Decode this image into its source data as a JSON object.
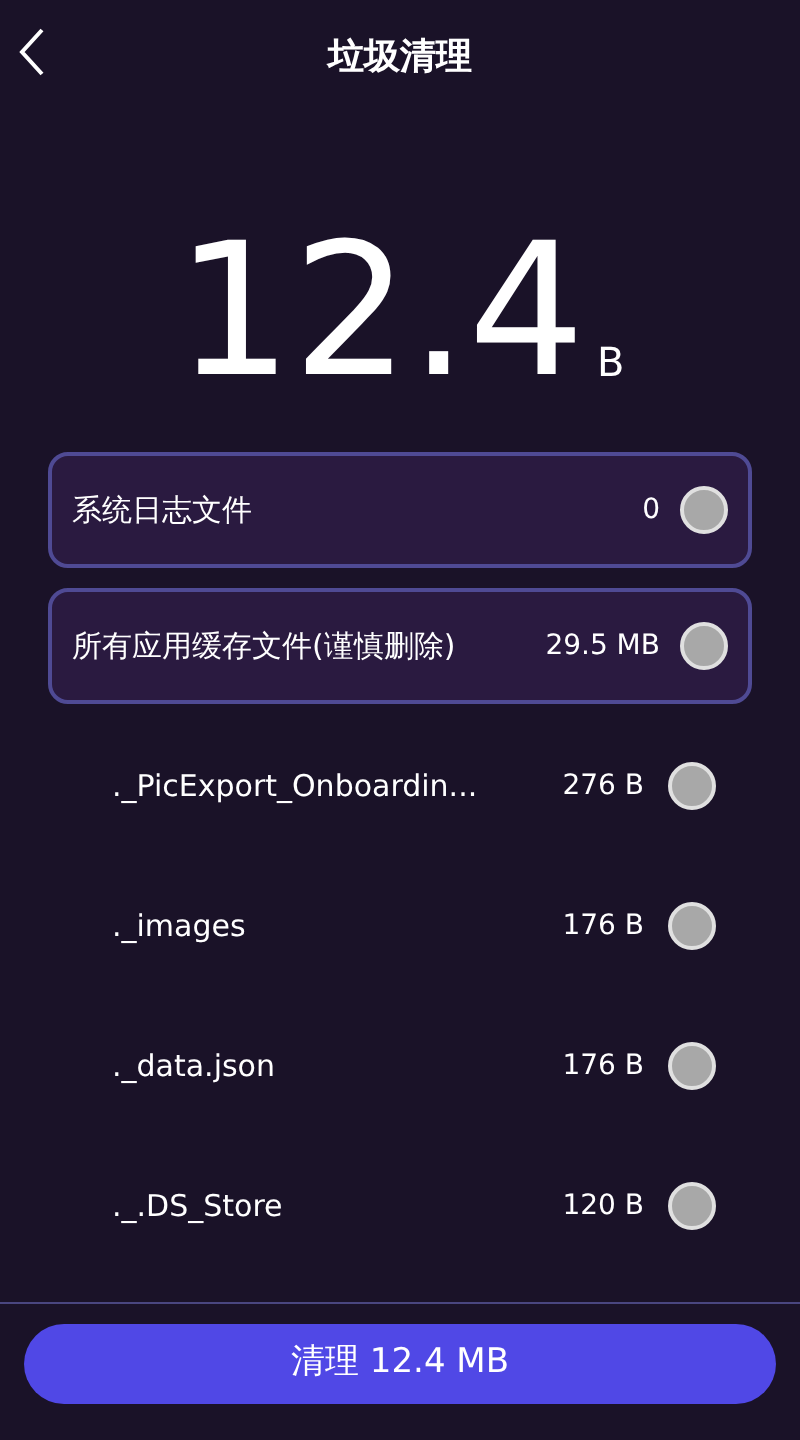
{
  "header": {
    "title": "垃圾清理"
  },
  "total": {
    "value": "12.4",
    "unit": "B"
  },
  "categories": [
    {
      "label": "系统日志文件",
      "size": "0",
      "checked": false
    },
    {
      "label": "所有应用缓存文件(谨慎删除)",
      "size": "29.5 MB",
      "checked": false
    }
  ],
  "files": [
    {
      "name": "._PicExport_Onboardin...",
      "size": "276 B",
      "checked": false
    },
    {
      "name": "._images",
      "size": "176 B",
      "checked": false
    },
    {
      "name": "._data.json",
      "size": "176 B",
      "checked": false
    },
    {
      "name": "._.DS_Store",
      "size": "120 B",
      "checked": false
    }
  ],
  "clean_button": {
    "label": "清理 12.4 MB"
  }
}
